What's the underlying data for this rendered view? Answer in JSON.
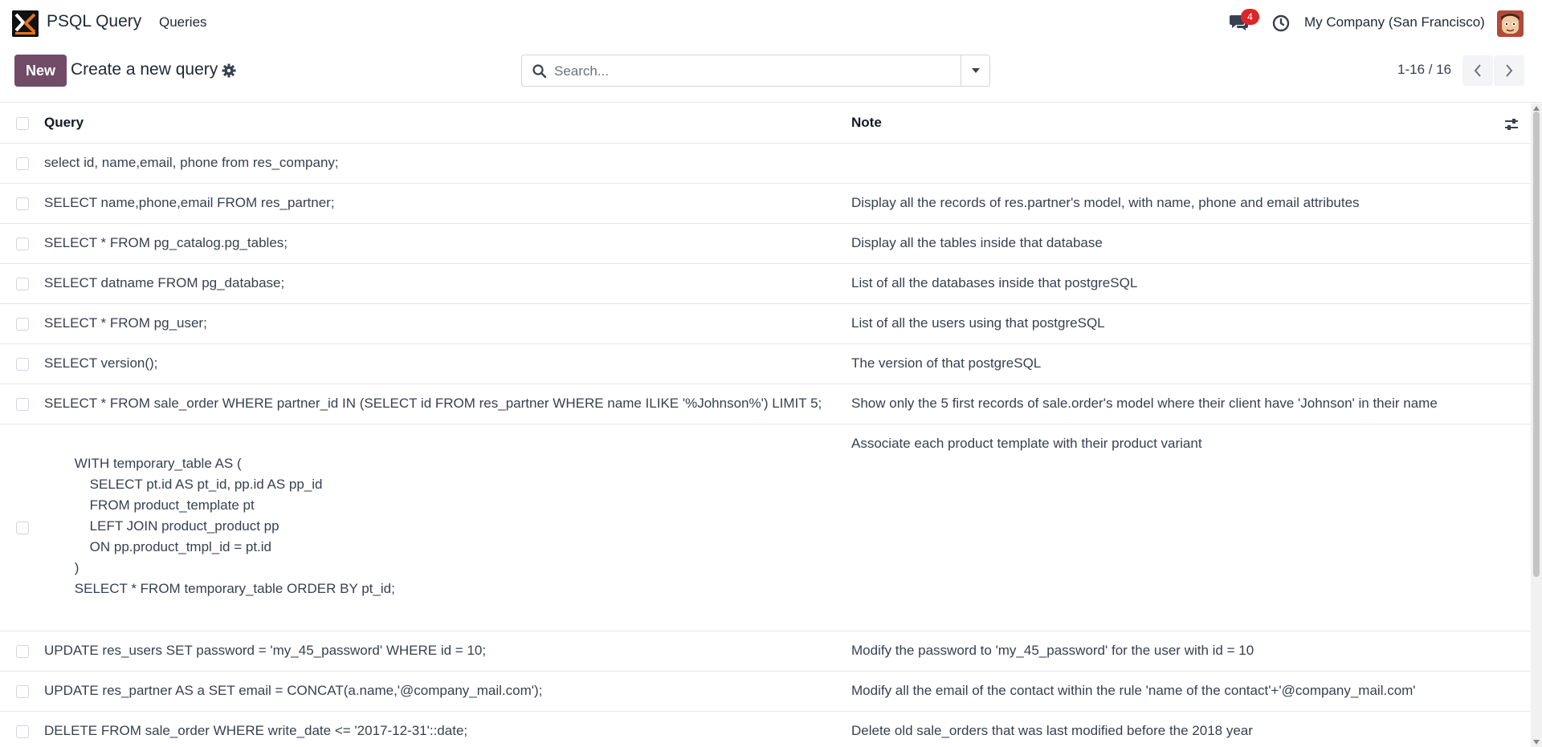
{
  "app": {
    "title": "PSQL Query"
  },
  "nav": {
    "menu_queries": "Queries"
  },
  "systray": {
    "notification_count": "4",
    "company": "My Company (San Francisco)"
  },
  "control": {
    "new_label": "New",
    "breadcrumb": "Create a new query",
    "search_placeholder": "Search...",
    "pager": "1-16 / 16"
  },
  "table": {
    "columns": {
      "query": "Query",
      "note": "Note"
    },
    "rows": [
      {
        "query": "select id, name,email, phone from res_company;",
        "note": ""
      },
      {
        "query": "SELECT name,phone,email FROM res_partner;",
        "note": "Display all the records of res.partner's model, with name, phone and email attributes"
      },
      {
        "query": "SELECT * FROM pg_catalog.pg_tables;",
        "note": "Display all the tables inside that database"
      },
      {
        "query": "SELECT datname FROM pg_database;",
        "note": "List of all the databases inside that postgreSQL"
      },
      {
        "query": "SELECT * FROM pg_user;",
        "note": "List of all the users using that postgreSQL"
      },
      {
        "query": "SELECT version();",
        "note": "The version of that postgreSQL"
      },
      {
        "query": "SELECT * FROM sale_order WHERE partner_id IN (SELECT id FROM res_partner WHERE name ILIKE '%Johnson%') LIMIT 5;",
        "note": "Show only the 5 first records of sale.order's model where their client have 'Johnson' in their name"
      },
      {
        "query": "        WITH temporary_table AS (\n            SELECT pt.id AS pt_id, pp.id AS pp_id\n            FROM product_template pt\n            LEFT JOIN product_product pp\n            ON pp.product_tmpl_id = pt.id\n        )\n        SELECT * FROM temporary_table ORDER BY pt_id;",
        "note": "Associate each product template with their product variant"
      },
      {
        "query": "UPDATE res_users SET password = 'my_45_password' WHERE id = 10;",
        "note": "Modify the password to 'my_45_password' for the user with id = 10"
      },
      {
        "query": "UPDATE res_partner AS a SET email = CONCAT(a.name,'@company_mail.com');",
        "note": "Modify all the email of the contact within the rule 'name of the contact'+'@company_mail.com'"
      },
      {
        "query": "DELETE FROM sale_order WHERE write_date <= '2017-12-31'::date;",
        "note": "Delete old sale_orders that was last modified before the 2018 year"
      }
    ]
  },
  "colors": {
    "primary": "#714b67",
    "badge": "#dc2626"
  },
  "icons": [
    "app-logo-icon",
    "chat-icon",
    "clock-icon",
    "avatar",
    "gear-icon",
    "search-icon",
    "caret-down-icon",
    "chevron-left-icon",
    "chevron-right-icon",
    "optional-columns-icon"
  ]
}
